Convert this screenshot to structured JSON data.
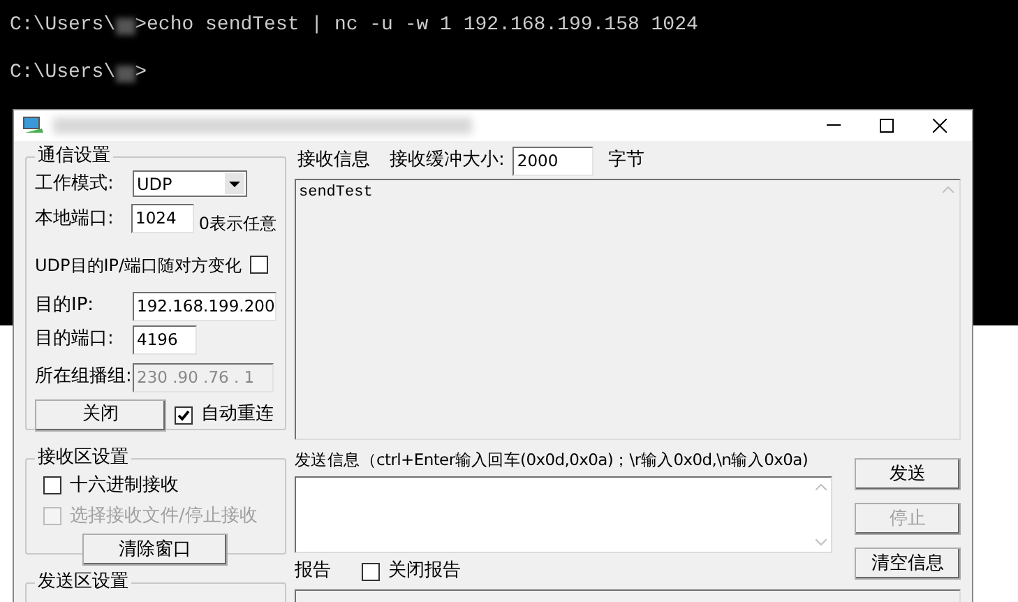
{
  "terminal": {
    "lines": [
      {
        "prompt": "C:\\Users\\",
        "command": ">echo sendTest | nc -u -w 1 192.168.199.158 1024"
      },
      {
        "prompt": "C:\\Users\\",
        "command": ">"
      }
    ]
  },
  "comm": {
    "title": "通信设置",
    "mode_label": "工作模式:",
    "mode": "UDP",
    "local_port_label": "本地端口:",
    "local_port": "1024",
    "local_port_hint": "0表示任意",
    "follow_label": "UDP目的IP/端口随对方变化",
    "follow_checked": false,
    "dest_ip_label": "目的IP:",
    "dest_ip": "192.168.199.200",
    "dest_port_label": "目的端口:",
    "dest_port": "4196",
    "group_label": "所在组播组:",
    "group": "230 .90 .76 . 1",
    "close_button": "关闭",
    "reconnect_label": "自动重连",
    "reconnect_checked": true
  },
  "recv_settings": {
    "title": "接收区设置",
    "options": [
      {
        "label": "十六进制接收",
        "checked": false,
        "disabled": false
      },
      {
        "label": "选择接收文件/停止接收",
        "checked": false,
        "disabled": true
      }
    ],
    "clear_button": "清除窗口"
  },
  "send_settings": {
    "title": "发送区设置"
  },
  "receive": {
    "label": "接收信息",
    "buffer_label": "接收缓冲大小:",
    "buffer": "2000",
    "unit": "字节",
    "content": "sendTest"
  },
  "send": {
    "label": "发送信息（ctrl+Enter输入回车(0x0d,0x0a)；\\r输入0x0d,\\n输入0x0a)",
    "buttons": [
      {
        "label": "发送",
        "disabled": false
      },
      {
        "label": "停止",
        "disabled": true
      },
      {
        "label": "清空信息",
        "disabled": false
      }
    ]
  },
  "report": {
    "label": "报告",
    "close_label": "关闭报告",
    "close_checked": false
  }
}
